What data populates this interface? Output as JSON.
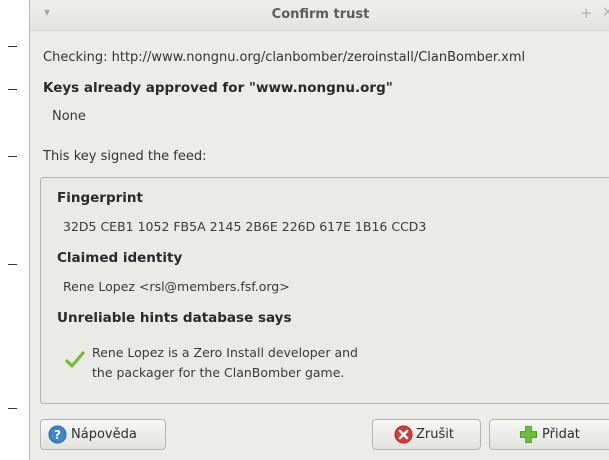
{
  "window": {
    "title": "Confirm trust",
    "menu_glyph": "▾",
    "maximize_glyph": "+",
    "close_glyph": "×"
  },
  "checking_text": "Checking: http://www.nongnu.org/clanbomber/zeroinstall/ClanBomber.xml",
  "approved_keys": {
    "title": "Keys already approved for \"www.nongnu.org\"",
    "value": "None"
  },
  "signed_label": "This key signed the feed:",
  "key_details": {
    "fingerprint_label": "Fingerprint",
    "fingerprint_value": "32D5 CEB1 1052 FB5A 2145 2B6E 226D 617E 1B16 CCD3",
    "identity_label": "Claimed identity",
    "identity_value": "Rene Lopez <rsl@members.fsf.org>",
    "hints_label": "Unreliable hints database says",
    "hints_line1": "Rene Lopez is a Zero Install developer and",
    "hints_line2": "the packager for the ClanBomber game."
  },
  "buttons": {
    "help": "Nápověda",
    "cancel": "Zrušit",
    "add": "Přidat"
  },
  "colors": {
    "window_bg": "#ececea",
    "help_icon": "#3a86cf",
    "cancel_icon": "#d83a33",
    "add_icon": "#6cbf3c",
    "check_icon": "#7cbc2f"
  }
}
